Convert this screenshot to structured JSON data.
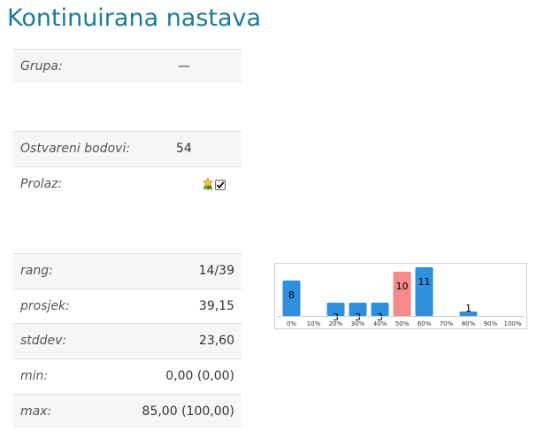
{
  "page_title": "Kontinuirana nastava",
  "info": {
    "group_label": "Grupa:",
    "group_value": "—",
    "points_label": "Ostvareni bodovi:",
    "points_value": "54",
    "pass_label": "Prolaz:",
    "pass_icons": [
      "certificate-icon",
      "checkbox-checked-icon"
    ],
    "pass_checked": true
  },
  "stats": {
    "rank_label": "rang:",
    "rank_value": "14/39",
    "mean_label": "prosjek:",
    "mean_value": "39,15",
    "stddev_label": "stddev:",
    "stddev_value": "23,60",
    "min_label": "min:",
    "min_value": "0,00 (0,00)",
    "max_label": "max:",
    "max_value": "85,00 (100,00)"
  },
  "colors": {
    "title": "#1b7a9c",
    "bar_default": "#2e8fde",
    "bar_highlight": "#f48a8a"
  },
  "chart_data": {
    "type": "bar",
    "categories": [
      "0%",
      "10%",
      "20%",
      "30%",
      "40%",
      "50%",
      "60%",
      "70%",
      "80%",
      "90%",
      "100%"
    ],
    "values": [
      8,
      0,
      3,
      3,
      3,
      10,
      11,
      0,
      1,
      0,
      0
    ],
    "highlight_index": 5,
    "ylim": [
      0,
      11
    ],
    "grid": false,
    "title": "",
    "xlabel": "",
    "ylabel": ""
  }
}
